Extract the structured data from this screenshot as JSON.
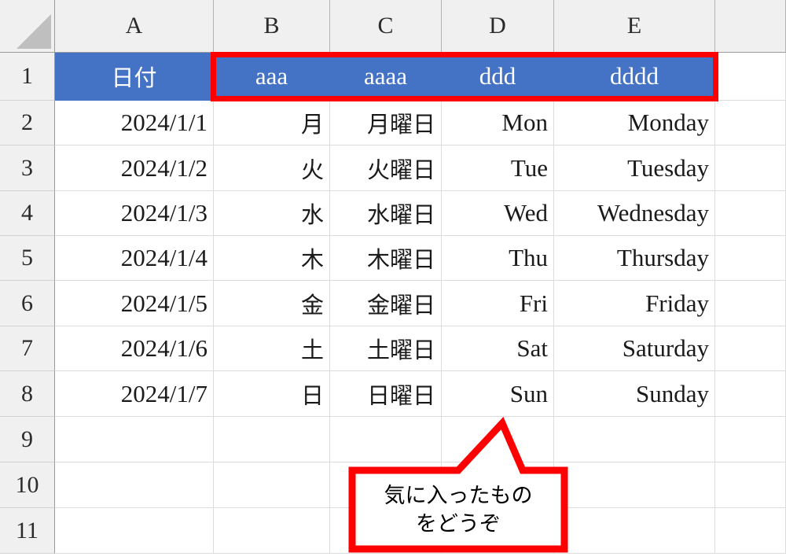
{
  "app": {
    "type": "spreadsheet",
    "select_all_icon": "select-all-triangle"
  },
  "grid": {
    "column_headers": [
      "A",
      "B",
      "C",
      "D",
      "E"
    ],
    "row_headers": [
      "1",
      "2",
      "3",
      "4",
      "5",
      "6",
      "7",
      "8",
      "9",
      "10",
      "11"
    ],
    "header_row_fill": "#4472C4",
    "header_row_text_color": "#FFFFFF",
    "gridline_color": "#DCDCDC",
    "header_bg": "#F0F0F0"
  },
  "rows": [
    {
      "num": "1",
      "a": "日付",
      "b": "aaa",
      "c": "aaaa",
      "d": "ddd",
      "e": "dddd",
      "is_header": true
    },
    {
      "num": "2",
      "a": "2024/1/1",
      "b": "月",
      "c": "月曜日",
      "d": "Mon",
      "e": "Monday",
      "is_header": false
    },
    {
      "num": "3",
      "a": "2024/1/2",
      "b": "火",
      "c": "火曜日",
      "d": "Tue",
      "e": "Tuesday",
      "is_header": false
    },
    {
      "num": "4",
      "a": "2024/1/3",
      "b": "水",
      "c": "水曜日",
      "d": "Wed",
      "e": "Wednesday",
      "is_header": false
    },
    {
      "num": "5",
      "a": "2024/1/4",
      "b": "木",
      "c": "木曜日",
      "d": "Thu",
      "e": "Thursday",
      "is_header": false
    },
    {
      "num": "6",
      "a": "2024/1/5",
      "b": "金",
      "c": "金曜日",
      "d": "Fri",
      "e": "Friday",
      "is_header": false
    },
    {
      "num": "7",
      "a": "2024/1/6",
      "b": "土",
      "c": "土曜日",
      "d": "Sat",
      "e": "Saturday",
      "is_header": false
    },
    {
      "num": "8",
      "a": "2024/1/7",
      "b": "日",
      "c": "日曜日",
      "d": "Sun",
      "e": "Sunday",
      "is_header": false
    },
    {
      "num": "9",
      "a": "",
      "b": "",
      "c": "",
      "d": "",
      "e": "",
      "is_header": false
    },
    {
      "num": "10",
      "a": "",
      "b": "",
      "c": "",
      "d": "",
      "e": "",
      "is_header": false
    },
    {
      "num": "11",
      "a": "",
      "b": "",
      "c": "",
      "d": "",
      "e": "",
      "is_header": false
    }
  ],
  "annotations": {
    "highlight": {
      "label": "header-range-highlight",
      "range": "B1:E1",
      "color": "#FF0000",
      "stroke_width": 7
    },
    "callout": {
      "label": "speech-callout",
      "color": "#FF0000",
      "fill": "#FFFFFF",
      "line1": "気に入ったもの",
      "line2": "をどうぞ"
    }
  }
}
